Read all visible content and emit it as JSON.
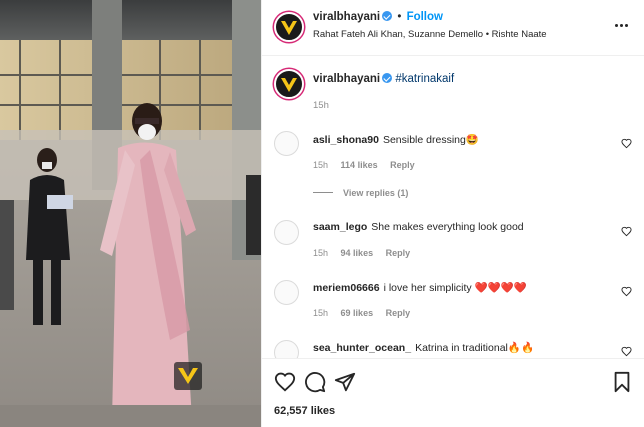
{
  "post": {
    "author": "viralbhayani",
    "separator": "•",
    "follow_label": "Follow",
    "music": "Rahat Fateh Ali Khan, Suzanne Demello • Rishte Naate",
    "caption_hashtag": "#katrinakaif",
    "caption_time": "15h",
    "likes": "62,557 likes"
  },
  "comments": [
    {
      "user": "asli_shona90",
      "text": "Sensible dressing🤩",
      "time": "15h",
      "likes": "114 likes",
      "reply": "Reply",
      "view_replies": "View replies (1)"
    },
    {
      "user": "saam_lego",
      "text": "She makes everything look good",
      "time": "15h",
      "likes": "94 likes",
      "reply": "Reply"
    },
    {
      "user": "meriem06666",
      "text": "i love her simplicity ❤️❤️❤️❤️",
      "time": "15h",
      "likes": "69 likes",
      "reply": "Reply"
    },
    {
      "user": "sea_hunter_ocean_",
      "text": "Katrina in traditional🔥🔥"
    }
  ],
  "colors": {
    "follow": "#0095f6",
    "verified": "#3897f0",
    "meta": "#8e8e8e",
    "accent_logo": "#f5c518"
  },
  "icons": [
    "heart-icon",
    "comment-icon",
    "share-icon",
    "save-icon",
    "more-options-icon",
    "verified-badge-icon"
  ]
}
